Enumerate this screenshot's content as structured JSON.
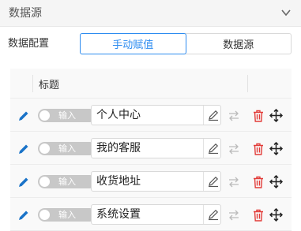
{
  "panel": {
    "title": "数据源"
  },
  "config": {
    "label": "数据配置",
    "tabs": [
      {
        "label": "手动赋值",
        "active": true
      },
      {
        "label": "数据源",
        "active": false
      }
    ]
  },
  "table": {
    "header": {
      "title": "标题"
    },
    "rows": [
      {
        "toggle_label": "输入",
        "value": "个人中心"
      },
      {
        "toggle_label": "输入",
        "value": "我的客服"
      },
      {
        "toggle_label": "输入",
        "value": "收货地址"
      },
      {
        "toggle_label": "输入",
        "value": "系统设置"
      }
    ]
  },
  "colors": {
    "accent": "#2d8cf0",
    "danger": "#e23c39",
    "toggle_off": "#c8c8c8"
  }
}
